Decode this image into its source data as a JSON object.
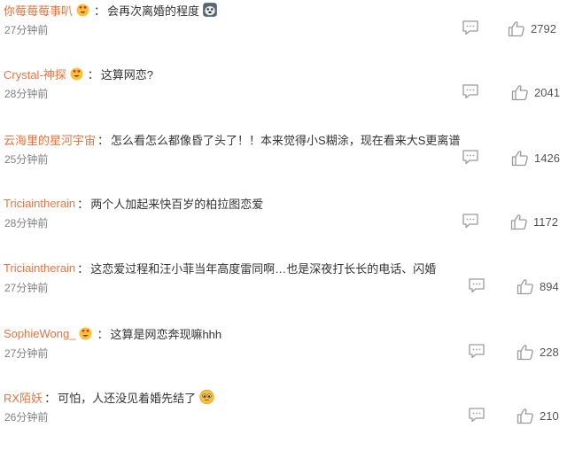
{
  "colors": {
    "username": "#eb7340",
    "text": "#333333",
    "time": "#808080",
    "icon": "#9a9a9a"
  },
  "comments": [
    {
      "user": "你莓莓莓事叭",
      "badge": "heart-eyes-emoji-icon",
      "sep": "：",
      "text": "会再次离婚的程度",
      "trailing_emoji": "dog-face-emoji-icon",
      "time": "27分钟前",
      "likes": "2792"
    },
    {
      "user": "Crystal-神探",
      "badge": "heart-eyes-emoji-icon",
      "sep": "：",
      "text": "这算网恋?",
      "time": "28分钟前",
      "likes": "2041"
    },
    {
      "user": "云海里的星河宇宙",
      "sep": "：",
      "text": "怎么看怎么都像昏了头了！！本来觉得小S糊涂，现在看来大S更离谱",
      "time": "25分钟前",
      "likes": "1426"
    },
    {
      "user": "Triciaintherain",
      "sep": "：",
      "text": "两个人加起来快百岁的柏拉图恋爱",
      "time": "28分钟前",
      "likes": "1172"
    },
    {
      "user": "Triciaintherain",
      "sep": "：",
      "text": "这恋爱过程和汪小菲当年高度雷同啊…也是深夜打长长的电话、闪婚",
      "time": "27分钟前",
      "likes": "894"
    },
    {
      "user": "SophieWong_",
      "badge": "heart-eyes-emoji-icon",
      "sep": "：",
      "text": "这算是网恋奔现嘛hhh",
      "time": "27分钟前",
      "likes": "228"
    },
    {
      "user": "RX陌妖",
      "sep": "：",
      "text": "可怕，人还没见着婚先结了",
      "trailing_emoji": "pleading-face-emoji-icon",
      "time": "26分钟前",
      "likes": "210"
    }
  ]
}
